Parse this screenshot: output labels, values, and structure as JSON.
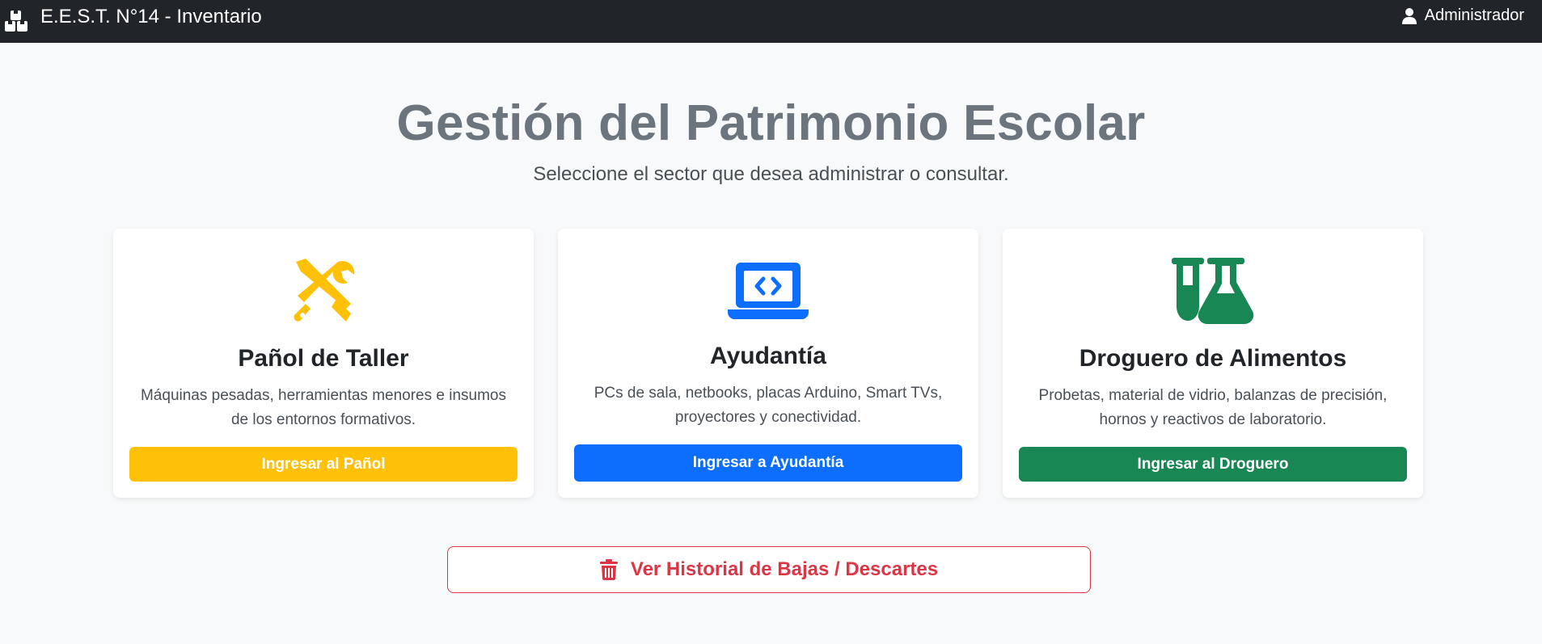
{
  "navbar": {
    "brand_icon": "boxes-icon",
    "brand_text": "E.E.S.T. N°14 - Inventario",
    "user_icon": "user-icon",
    "user_label": "Administrador"
  },
  "hero": {
    "title": "Gestión del Patrimonio Escolar",
    "subtitle": "Seleccione el sector que desea administrar o consultar."
  },
  "cards": [
    {
      "icon": "tools-icon",
      "title": "Pañol de Taller",
      "description": "Máquinas pesadas, herramientas menores e insumos de los entornos formativos.",
      "button": "Ingresar al Pañol",
      "color": "#ffc107"
    },
    {
      "icon": "laptop-code-icon",
      "title": "Ayudantía",
      "description": "PCs de sala, netbooks, placas Arduino, Smart TVs, proyectores y conectividad.",
      "button": "Ingresar a Ayudantía",
      "color": "#0d6efd"
    },
    {
      "icon": "flask-vial-icon",
      "title": "Droguero de Alimentos",
      "description": "Probetas, material de vidrio, balanzas de precisión, hornos y reactivos de laboratorio.",
      "button": "Ingresar al Droguero",
      "color": "#198754"
    }
  ],
  "history_button": {
    "icon": "trash-icon",
    "label": "Ver Historial de Bajas / Descartes",
    "color": "#dc3545"
  }
}
